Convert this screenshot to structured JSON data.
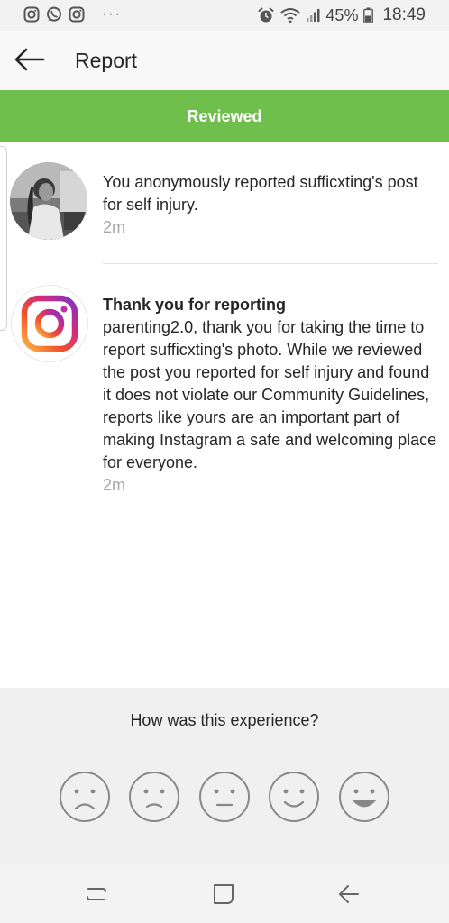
{
  "status_bar": {
    "left_icons": [
      "instagram-icon",
      "whatsapp-icon",
      "instagram-icon"
    ],
    "more": "···",
    "battery_percent": "45%",
    "time": "18:49"
  },
  "app_bar": {
    "back_icon": "back-arrow-icon",
    "title": "Report"
  },
  "banner": {
    "label": "Reviewed",
    "color": "#6ebf4c"
  },
  "notifications": [
    {
      "avatar": "user-avatar",
      "text": "You anonymously reported sufficxting's post for self injury.",
      "time": "2m"
    },
    {
      "avatar": "instagram-logo",
      "title": "Thank you for reporting",
      "text": "parenting2.0, thank you for taking the time to report sufficxting's photo. While we reviewed the post you reported for self injury and found it does not violate our Community Guidelines, reports like yours are an important part of making Instagram a safe and welcoming place for everyone.",
      "time": "2m"
    }
  ],
  "feedback": {
    "question": "How was this experience?",
    "options": [
      "very-sad-face-icon",
      "sad-face-icon",
      "neutral-face-icon",
      "happy-face-icon",
      "very-happy-face-icon"
    ]
  },
  "nav_bar": {
    "icons": [
      "recent-apps-icon",
      "home-icon",
      "back-icon"
    ]
  }
}
